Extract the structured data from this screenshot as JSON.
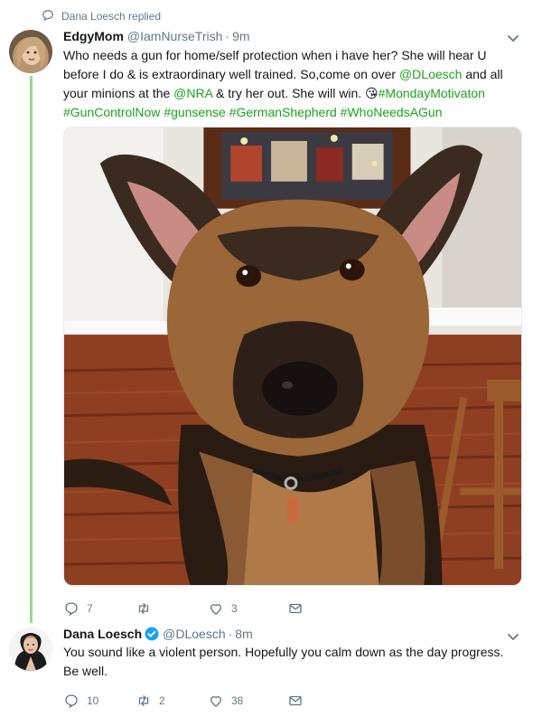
{
  "context": {
    "text": "Dana Loesch replied"
  },
  "tweet1": {
    "name": "EdgyMom",
    "handle": "@IamNurseTrish",
    "time": "9m",
    "text_parts": [
      "Who needs a gun for home/self protection when i have her? She will hear U before I do & is extraordinary well trained. So,come on over ",
      "@DLoesch",
      " and all your minions at the ",
      "@NRA",
      " & try her out. She will win. ",
      "😘",
      "#MondayMotivaton",
      " ",
      "#GunControlNow",
      " ",
      "#gunsense",
      " ",
      "#GermanShepherd",
      " ",
      "#WhoNeedsAGun"
    ],
    "reply_count": "7",
    "retweet_count": "",
    "like_count": "3"
  },
  "tweet2": {
    "name": "Dana Loesch",
    "handle": "@DLoesch",
    "time": "8m",
    "text": "You sound like a violent person. Hopefully you calm down as the day progress. Be well.",
    "reply_count": "10",
    "retweet_count": "2",
    "like_count": "38"
  },
  "colors": {
    "link": "#1ea31e",
    "thread_line": "#9ad98a",
    "muted": "#657786",
    "verified": "#1da1f2"
  },
  "icons": [
    "reply-indicator-icon",
    "caret-down-icon",
    "reply-icon",
    "retweet-icon",
    "like-icon",
    "dm-icon",
    "verified-badge-icon"
  ]
}
